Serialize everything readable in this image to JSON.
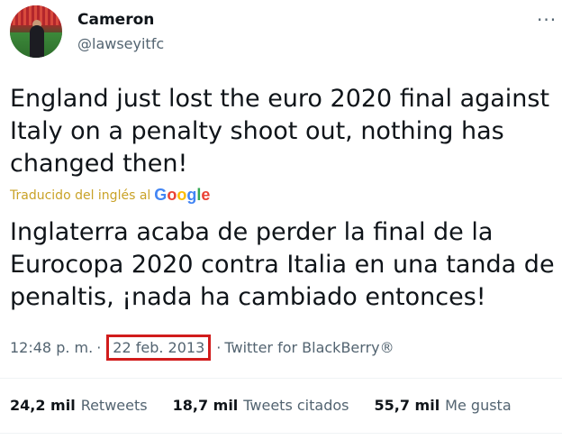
{
  "author": {
    "display_name": "Cameron",
    "handle": "@lawseyitfc"
  },
  "menu_icon": "more-horizontal-icon",
  "tweet": {
    "text": "England just lost the euro 2020 final against\nItaly on a penalty shoot out, nothing has\nchanged then!",
    "translated_label": "Traducido del inglés al",
    "translated_provider": "Google",
    "translation": "Inglaterra acaba de perder la final de la\nEurocopa 2020 contra Italia en una tanda de\npenaltis, ¡nada ha cambiado entonces!"
  },
  "meta": {
    "time": "12:48 p. m.",
    "separator": "·",
    "date": "22 feb. 2013",
    "source": "Twitter for BlackBerry®",
    "highlight_color": "#d11c1c"
  },
  "stats": [
    {
      "value": "24,2 mil",
      "label": "Retweets"
    },
    {
      "value": "18,7 mil",
      "label": "Tweets citados"
    },
    {
      "value": "55,7 mil",
      "label": "Me gusta"
    }
  ]
}
